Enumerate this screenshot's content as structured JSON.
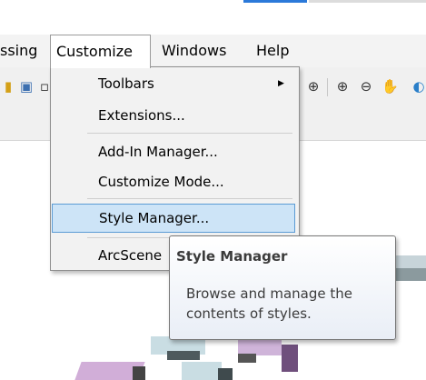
{
  "menubar": {
    "items": [
      {
        "label": "ssing"
      },
      {
        "label": "Customize"
      },
      {
        "label": "Windows"
      },
      {
        "label": "Help"
      }
    ]
  },
  "customize_menu": {
    "items": [
      {
        "label": "Toolbars",
        "has_submenu": true
      },
      {
        "label": "Extensions..."
      },
      {
        "label": "Add-In Manager..."
      },
      {
        "label": "Customize Mode..."
      },
      {
        "label": "Style Manager...",
        "highlighted": true
      },
      {
        "label": "ArcScene"
      }
    ]
  },
  "tooltip": {
    "title": "Style Manager",
    "description": "Browse and manage the contents of styles."
  },
  "toolbar": {
    "icons": [
      "layer-icon",
      "window-icon",
      "navigate-icon",
      "zoom-in-icon",
      "zoom-out-icon",
      "pan-icon",
      "globe-icon"
    ]
  },
  "colors": {
    "highlight_bg": "#cde4f7",
    "highlight_border": "#5b9bd5",
    "menu_bg": "#f2f2f2"
  }
}
